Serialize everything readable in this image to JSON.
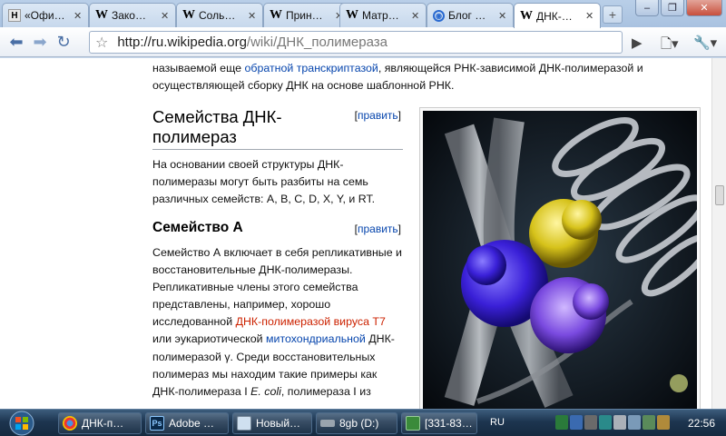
{
  "browser": {
    "tabs": [
      {
        "label": "«Офи…",
        "icon": "h-icon"
      },
      {
        "label": "Зако…",
        "icon": "wikipedia-icon"
      },
      {
        "label": "Соль…",
        "icon": "wikipedia-icon"
      },
      {
        "label": "Прин…",
        "icon": "wikipedia-icon"
      },
      {
        "label": "Матр…",
        "icon": "wikipedia-icon"
      },
      {
        "label": "Блог …",
        "icon": "blog-icon"
      },
      {
        "label": "ДНК-…",
        "icon": "wikipedia-icon",
        "active": true
      }
    ],
    "url_base": "http://ru.wikipedia.org",
    "url_path": "/wiki/ДНК_полимераза"
  },
  "article": {
    "intro_pre": "называемой еще ",
    "intro_link": "обратной транскриптазой",
    "intro_post": ", являющейся РНК-зависимой ДНК-полимеразой и осуществляющей сборку ДНК на основе шаблонной РНК.",
    "section_title": "Семейства ДНК-полимераз",
    "edit_label": "[править]",
    "section_text": "На основании своей структуры ДНК-полимеразы могут быть разбиты на семь различных семейств: A, B, C, D, X, Y, и RT.",
    "subsection_title": "Семейство А",
    "p1": "Семейство А включает в себя репликативные и восстановительные ДНК-полимеразы. Репликативные члены этого семейства представлены, например, хорошо исследованной ",
    "p1_link": "ДНК-полимеразой вируса Т7",
    "p2": " или эукариотической ",
    "p2_link": "митохондриальной",
    "p3": " ДНК-полимеразой γ. Среди восстановительных полимераз мы находим такие примеры как ДНК-полимераза I ",
    "p3_italic": "E. coli",
    "p4": ", полимераза I из"
  },
  "taskbar": {
    "tasks": [
      {
        "label": "ДНК-п…",
        "icon": "chrome-icon"
      },
      {
        "label": "Adobe …",
        "icon": "photoshop-icon"
      },
      {
        "label": "Новый…",
        "icon": "notepad-icon"
      },
      {
        "label": "8gb (D:)",
        "icon": "drive-icon"
      },
      {
        "label": "[331-83…",
        "icon": "app-icon"
      }
    ],
    "lang": "RU",
    "clock": "22:56"
  },
  "colors": {
    "link": "#0645ad",
    "redlink": "#cc2200",
    "taskbar": "#1d3550"
  }
}
